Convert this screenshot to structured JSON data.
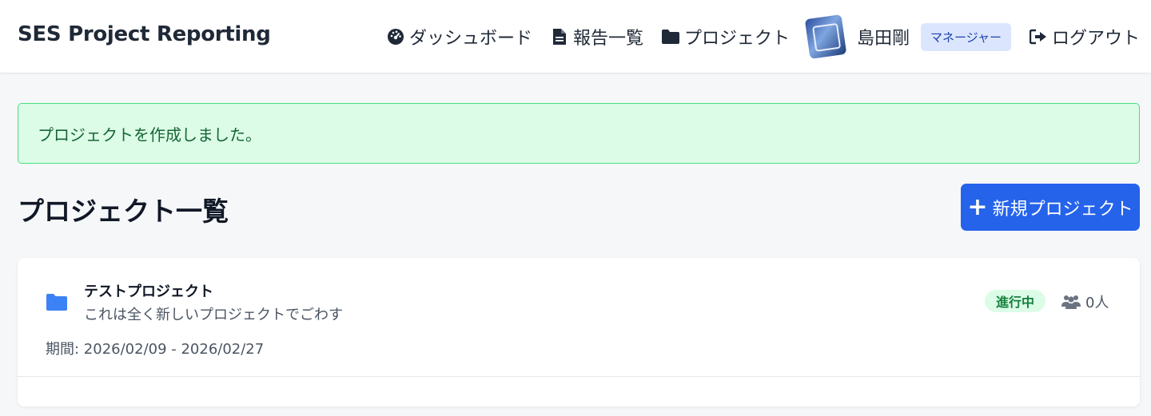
{
  "app": {
    "title": "SES Project Reporting"
  },
  "nav": {
    "items": [
      {
        "label": "ダッシュボード",
        "icon": "dashboard-gauge-icon"
      },
      {
        "label": "報告一覧",
        "icon": "file-icon"
      },
      {
        "label": "プロジェクト",
        "icon": "folder-icon"
      }
    ],
    "user_name": "島田剛",
    "role": "マネージャー",
    "logout_label": "ログアウト",
    "logout_icon": "logout-icon"
  },
  "alert": {
    "message": "プロジェクトを作成しました。"
  },
  "page": {
    "title": "プロジェクト一覧",
    "new_button_label": "新規プロジェクト"
  },
  "projects": [
    {
      "name": "テストプロジェクト",
      "description": "これは全く新しいプロジェクトでごわす",
      "period": "期間: 2026/02/09 - 2026/02/27",
      "status": "進行中",
      "members": "0人"
    }
  ],
  "colors": {
    "primary": "#2563eb",
    "success_bg": "#dcfce7",
    "success_border": "#4ade80",
    "success_text": "#166534",
    "role_badge_bg": "#dbe6fe",
    "folder_icon": "#3b82f6"
  }
}
